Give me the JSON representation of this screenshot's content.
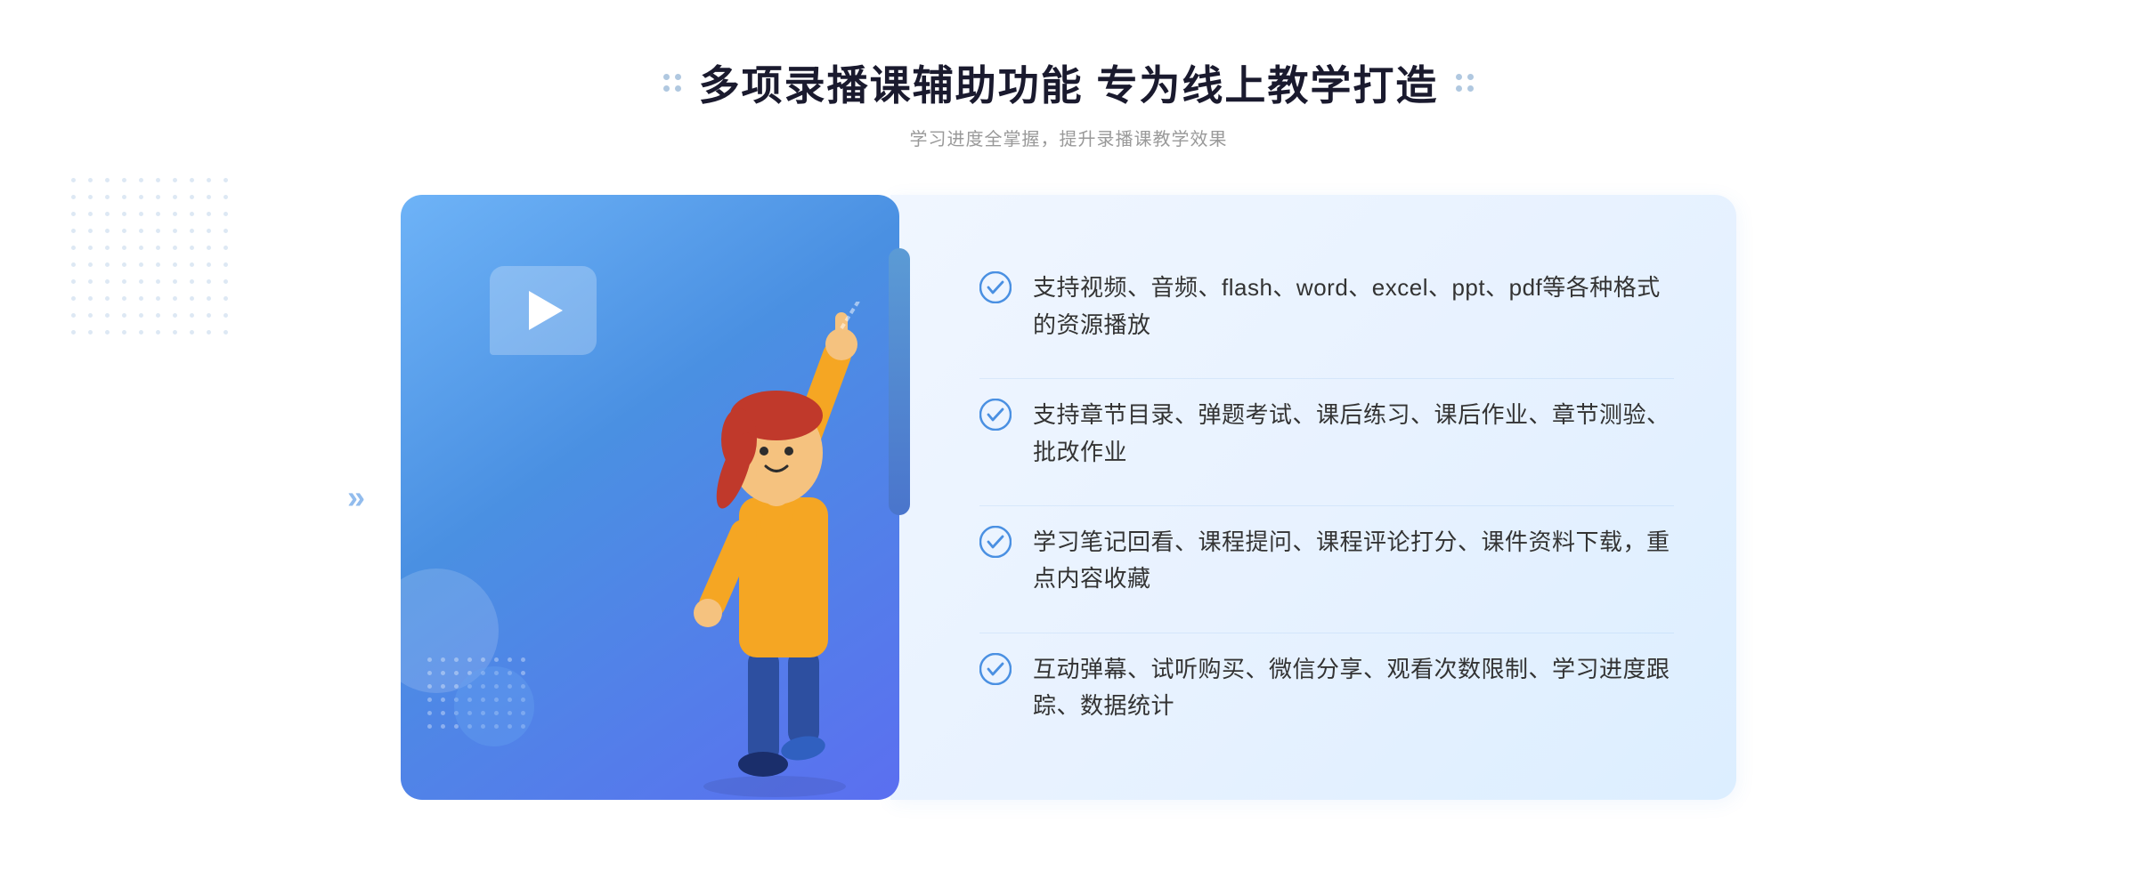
{
  "header": {
    "title": "多项录播课辅助功能 专为线上教学打造",
    "subtitle": "学习进度全掌握，提升录播课教学效果"
  },
  "features": [
    {
      "id": 1,
      "text": "支持视频、音频、flash、word、excel、ppt、pdf等各种格式的资源播放"
    },
    {
      "id": 2,
      "text": "支持章节目录、弹题考试、课后练习、课后作业、章节测验、批改作业"
    },
    {
      "id": 3,
      "text": "学习笔记回看、课程提问、课程评论打分、课件资料下载，重点内容收藏"
    },
    {
      "id": 4,
      "text": "互动弹幕、试听购买、微信分享、观看次数限制、学习进度跟踪、数据统计"
    }
  ],
  "decorators": {
    "left_arrow": "»",
    "check_color": "#4a90e2"
  }
}
